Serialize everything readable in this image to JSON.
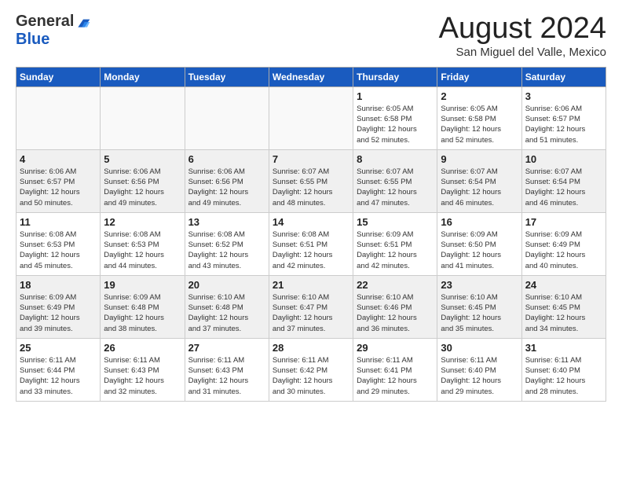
{
  "logo": {
    "general": "General",
    "blue": "Blue"
  },
  "title": "August 2024",
  "location": "San Miguel del Valle, Mexico",
  "days_of_week": [
    "Sunday",
    "Monday",
    "Tuesday",
    "Wednesday",
    "Thursday",
    "Friday",
    "Saturday"
  ],
  "weeks": [
    [
      {
        "day": "",
        "info": ""
      },
      {
        "day": "",
        "info": ""
      },
      {
        "day": "",
        "info": ""
      },
      {
        "day": "",
        "info": ""
      },
      {
        "day": "1",
        "info": "Sunrise: 6:05 AM\nSunset: 6:58 PM\nDaylight: 12 hours\nand 52 minutes."
      },
      {
        "day": "2",
        "info": "Sunrise: 6:05 AM\nSunset: 6:58 PM\nDaylight: 12 hours\nand 52 minutes."
      },
      {
        "day": "3",
        "info": "Sunrise: 6:06 AM\nSunset: 6:57 PM\nDaylight: 12 hours\nand 51 minutes."
      }
    ],
    [
      {
        "day": "4",
        "info": "Sunrise: 6:06 AM\nSunset: 6:57 PM\nDaylight: 12 hours\nand 50 minutes."
      },
      {
        "day": "5",
        "info": "Sunrise: 6:06 AM\nSunset: 6:56 PM\nDaylight: 12 hours\nand 49 minutes."
      },
      {
        "day": "6",
        "info": "Sunrise: 6:06 AM\nSunset: 6:56 PM\nDaylight: 12 hours\nand 49 minutes."
      },
      {
        "day": "7",
        "info": "Sunrise: 6:07 AM\nSunset: 6:55 PM\nDaylight: 12 hours\nand 48 minutes."
      },
      {
        "day": "8",
        "info": "Sunrise: 6:07 AM\nSunset: 6:55 PM\nDaylight: 12 hours\nand 47 minutes."
      },
      {
        "day": "9",
        "info": "Sunrise: 6:07 AM\nSunset: 6:54 PM\nDaylight: 12 hours\nand 46 minutes."
      },
      {
        "day": "10",
        "info": "Sunrise: 6:07 AM\nSunset: 6:54 PM\nDaylight: 12 hours\nand 46 minutes."
      }
    ],
    [
      {
        "day": "11",
        "info": "Sunrise: 6:08 AM\nSunset: 6:53 PM\nDaylight: 12 hours\nand 45 minutes."
      },
      {
        "day": "12",
        "info": "Sunrise: 6:08 AM\nSunset: 6:53 PM\nDaylight: 12 hours\nand 44 minutes."
      },
      {
        "day": "13",
        "info": "Sunrise: 6:08 AM\nSunset: 6:52 PM\nDaylight: 12 hours\nand 43 minutes."
      },
      {
        "day": "14",
        "info": "Sunrise: 6:08 AM\nSunset: 6:51 PM\nDaylight: 12 hours\nand 42 minutes."
      },
      {
        "day": "15",
        "info": "Sunrise: 6:09 AM\nSunset: 6:51 PM\nDaylight: 12 hours\nand 42 minutes."
      },
      {
        "day": "16",
        "info": "Sunrise: 6:09 AM\nSunset: 6:50 PM\nDaylight: 12 hours\nand 41 minutes."
      },
      {
        "day": "17",
        "info": "Sunrise: 6:09 AM\nSunset: 6:49 PM\nDaylight: 12 hours\nand 40 minutes."
      }
    ],
    [
      {
        "day": "18",
        "info": "Sunrise: 6:09 AM\nSunset: 6:49 PM\nDaylight: 12 hours\nand 39 minutes."
      },
      {
        "day": "19",
        "info": "Sunrise: 6:09 AM\nSunset: 6:48 PM\nDaylight: 12 hours\nand 38 minutes."
      },
      {
        "day": "20",
        "info": "Sunrise: 6:10 AM\nSunset: 6:48 PM\nDaylight: 12 hours\nand 37 minutes."
      },
      {
        "day": "21",
        "info": "Sunrise: 6:10 AM\nSunset: 6:47 PM\nDaylight: 12 hours\nand 37 minutes."
      },
      {
        "day": "22",
        "info": "Sunrise: 6:10 AM\nSunset: 6:46 PM\nDaylight: 12 hours\nand 36 minutes."
      },
      {
        "day": "23",
        "info": "Sunrise: 6:10 AM\nSunset: 6:45 PM\nDaylight: 12 hours\nand 35 minutes."
      },
      {
        "day": "24",
        "info": "Sunrise: 6:10 AM\nSunset: 6:45 PM\nDaylight: 12 hours\nand 34 minutes."
      }
    ],
    [
      {
        "day": "25",
        "info": "Sunrise: 6:11 AM\nSunset: 6:44 PM\nDaylight: 12 hours\nand 33 minutes."
      },
      {
        "day": "26",
        "info": "Sunrise: 6:11 AM\nSunset: 6:43 PM\nDaylight: 12 hours\nand 32 minutes."
      },
      {
        "day": "27",
        "info": "Sunrise: 6:11 AM\nSunset: 6:43 PM\nDaylight: 12 hours\nand 31 minutes."
      },
      {
        "day": "28",
        "info": "Sunrise: 6:11 AM\nSunset: 6:42 PM\nDaylight: 12 hours\nand 30 minutes."
      },
      {
        "day": "29",
        "info": "Sunrise: 6:11 AM\nSunset: 6:41 PM\nDaylight: 12 hours\nand 29 minutes."
      },
      {
        "day": "30",
        "info": "Sunrise: 6:11 AM\nSunset: 6:40 PM\nDaylight: 12 hours\nand 29 minutes."
      },
      {
        "day": "31",
        "info": "Sunrise: 6:11 AM\nSunset: 6:40 PM\nDaylight: 12 hours\nand 28 minutes."
      }
    ]
  ]
}
